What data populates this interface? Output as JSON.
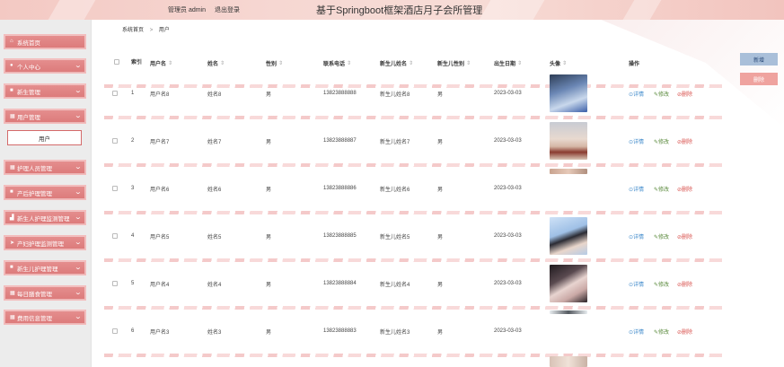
{
  "header": {
    "user_text": "管理员 admin",
    "logout": "退出登录",
    "title": "基于Springboot框架酒店月子会所管理"
  },
  "sidebar": {
    "items": [
      {
        "label": "系统首页",
        "icon": "home-icon",
        "glyph": "⌂"
      },
      {
        "label": "个人中心",
        "icon": "user-icon",
        "glyph": "●"
      },
      {
        "label": "新生管理",
        "icon": "baby-icon",
        "glyph": "■"
      },
      {
        "label": "用户管理",
        "icon": "users-icon",
        "glyph": "▦"
      },
      {
        "label": "护理人员管理",
        "icon": "nurse-icon",
        "glyph": "▦"
      },
      {
        "label": "产后护理管理",
        "icon": "care-icon",
        "glyph": "■"
      },
      {
        "label": "新生人护理监测管理",
        "icon": "chart-icon",
        "glyph": "▟"
      },
      {
        "label": "产妇护理监测管理",
        "icon": "send-icon",
        "glyph": "➤"
      },
      {
        "label": "新生儿护理管理",
        "icon": "bag-icon",
        "glyph": "■"
      },
      {
        "label": "每日膳食管理",
        "icon": "grid-icon",
        "glyph": "▦"
      },
      {
        "label": "费用信息管理",
        "icon": "grid-icon",
        "glyph": "▦"
      }
    ],
    "sub_item": "用户"
  },
  "breadcrumb": {
    "home": "系统首页",
    "sep": ">",
    "current": "用户"
  },
  "buttons": {
    "add": "新增",
    "delete": "删除"
  },
  "table": {
    "columns": {
      "index": "索引",
      "username": "用户名",
      "name": "姓名",
      "gender": "性别",
      "phone": "联系电话",
      "baby_name": "新生儿姓名",
      "baby_gender": "新生儿性别",
      "birth": "出生日期",
      "avatar": "头像",
      "ops": "操作"
    },
    "sort_glyph": "⇕",
    "actions": {
      "view": "⊙详情",
      "edit": "✎修改",
      "remove": "⊘删除"
    },
    "rows": [
      {
        "idx": "1",
        "username": "用户名8",
        "name": "姓名8",
        "gender": "男",
        "phone": "13823888888",
        "baby_name": "新生儿姓名8",
        "baby_gender": "男",
        "birth": "2023-03-03"
      },
      {
        "idx": "2",
        "username": "用户名7",
        "name": "姓名7",
        "gender": "男",
        "phone": "13823888887",
        "baby_name": "新生儿姓名7",
        "baby_gender": "男",
        "birth": "2023-03-03"
      },
      {
        "idx": "3",
        "username": "用户名6",
        "name": "姓名6",
        "gender": "男",
        "phone": "13823888886",
        "baby_name": "新生儿姓名6",
        "baby_gender": "男",
        "birth": "2023-03-03"
      },
      {
        "idx": "4",
        "username": "用户名5",
        "name": "姓名5",
        "gender": "男",
        "phone": "13823888885",
        "baby_name": "新生儿姓名5",
        "baby_gender": "男",
        "birth": "2023-03-03"
      },
      {
        "idx": "5",
        "username": "用户名4",
        "name": "姓名4",
        "gender": "男",
        "phone": "13823888884",
        "baby_name": "新生儿姓名4",
        "baby_gender": "男",
        "birth": "2023-03-03"
      },
      {
        "idx": "6",
        "username": "用户名3",
        "name": "姓名3",
        "gender": "男",
        "phone": "13823888883",
        "baby_name": "新生儿姓名3",
        "baby_gender": "男",
        "birth": "2023-03-03"
      }
    ]
  },
  "colors": {
    "accent": "#dc7a7a",
    "sidebar_bg": "#ececec",
    "link": "#3f8acb",
    "danger": "#d9534f"
  }
}
